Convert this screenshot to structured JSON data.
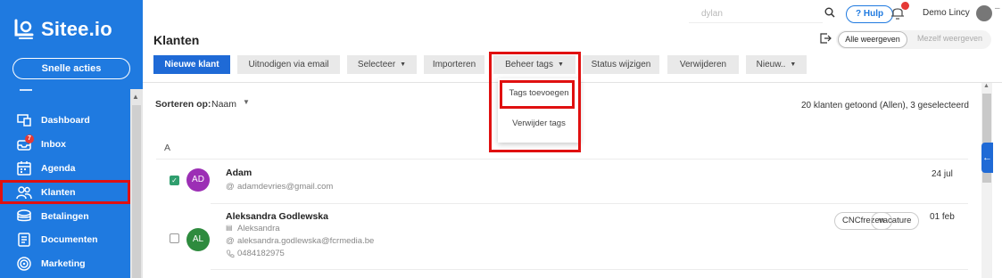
{
  "app": {
    "name": "Sitee.io"
  },
  "sidebar": {
    "quick_actions": "Snelle acties",
    "items": [
      {
        "label": "Dashboard",
        "icon": "dashboard-icon"
      },
      {
        "label": "Inbox",
        "icon": "inbox-icon",
        "badge": "7"
      },
      {
        "label": "Agenda",
        "icon": "calendar-icon"
      },
      {
        "label": "Klanten",
        "icon": "users-icon",
        "active": true
      },
      {
        "label": "Betalingen",
        "icon": "payments-icon"
      },
      {
        "label": "Documenten",
        "icon": "document-icon"
      },
      {
        "label": "Marketing",
        "icon": "target-icon"
      }
    ]
  },
  "topbar": {
    "search_value": "dylan",
    "help": "? Hulp",
    "user": "Demo Lincy"
  },
  "header": {
    "title": "Klanten",
    "view_all": "Alle weergeven",
    "view_self": "Mezelf weergeven"
  },
  "toolbar": {
    "new_client": "Nieuwe klant",
    "invite_email": "Uitnodigen via email",
    "select": "Selecteer",
    "import": "Importeren",
    "manage_tags": "Beheer tags",
    "change_status": "Status wijzigen",
    "delete": "Verwijderen",
    "new_more": "Nieuw.."
  },
  "dropdown": {
    "add_tags": "Tags toevoegen",
    "remove_tags": "Verwijder tags"
  },
  "list": {
    "sort_label": "Sorteren op:",
    "sort_value": "Naam",
    "count_text": "20 klanten getoond (Allen), 3 geselecteerd",
    "group_letter": "A",
    "clients": [
      {
        "initials": "AD",
        "name": "Adam",
        "email": "adamdevries@gmail.com",
        "date": "24 jul",
        "checked": true,
        "avatar_color": "#9c2fb5"
      },
      {
        "initials": "AL",
        "name": "Aleksandra Godlewska",
        "company": "Aleksandra",
        "email": "aleksandra.godlewska@fcrmedia.be",
        "phone": "0484182975",
        "date": "01 feb",
        "checked": false,
        "avatar_color": "#2e8b3e",
        "tags": [
          "CNCfrezen",
          "vacature"
        ]
      }
    ]
  },
  "colors": {
    "sidebar": "#1f7ae0",
    "primary_button": "#1f6ad6",
    "highlight": "#e01010"
  }
}
